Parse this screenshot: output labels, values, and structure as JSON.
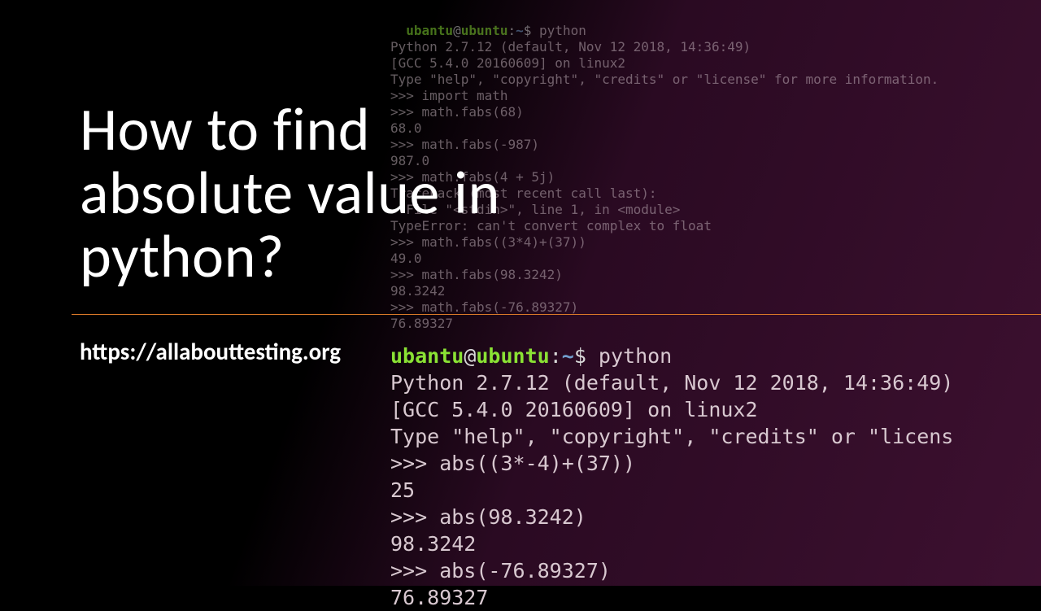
{
  "title": "How to find\nabsolute value in\npython?",
  "url": "https://allabouttesting.org",
  "terminal_top": {
    "prompt": {
      "user": "ubantu",
      "host": "ubuntu",
      "path": "~",
      "cmd": "python"
    },
    "lines": [
      "Python 2.7.12 (default, Nov 12 2018, 14:36:49)",
      "[GCC 5.4.0 20160609] on linux2",
      "Type \"help\", \"copyright\", \"credits\" or \"license\" for more information.",
      ">>> import math",
      ">>> math.fabs(68)",
      "68.0",
      ">>> math.fabs(-987)",
      "987.0",
      ">>> math.fabs(4 + 5j)",
      "Traceback (most recent call last):",
      "  File \"<stdin>\", line 1, in <module>",
      "TypeError: can't convert complex to float",
      ">>> math.fabs((3*4)+(37))",
      "49.0",
      ">>> math.fabs(98.3242)",
      "98.3242",
      ">>> math.fabs(-76.89327)",
      "76.89327"
    ]
  },
  "terminal_bottom": {
    "prompt": {
      "user": "ubantu",
      "host": "ubuntu",
      "path": "~",
      "cmd": "python"
    },
    "lines": [
      "Python 2.7.12 (default, Nov 12 2018, 14:36:49)",
      "[GCC 5.4.0 20160609] on linux2",
      "Type \"help\", \"copyright\", \"credits\" or \"licens",
      ">>> abs((3*-4)+(37))",
      "25",
      ">>> abs(98.3242)",
      "98.3242",
      ">>> abs(-76.89327)",
      "76.89327"
    ]
  }
}
